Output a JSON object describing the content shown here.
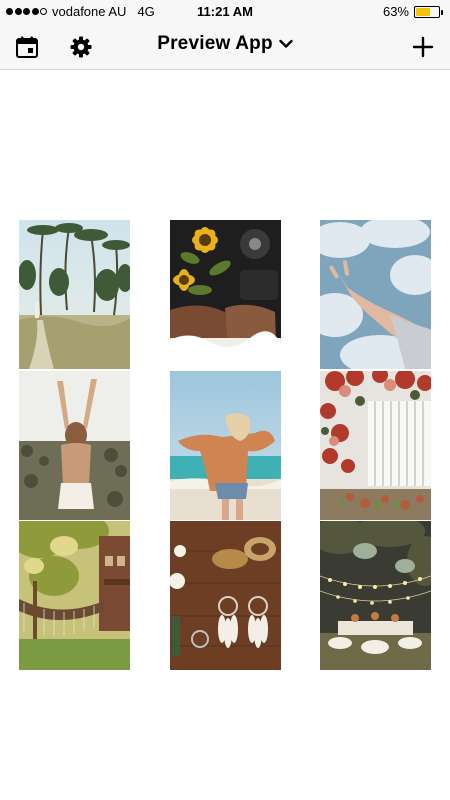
{
  "status_bar": {
    "carrier": "vodafone AU",
    "network": "4G",
    "time": "11:21 AM",
    "battery_percent": "63%",
    "battery_level": 0.63,
    "signal_bars_filled": 4,
    "battery_color": "#f5c10a"
  },
  "nav": {
    "title": "Preview App",
    "left_icons": [
      "calendar-icon",
      "gear-icon"
    ],
    "title_icon": "chevron-down-icon",
    "right_icon": "plus-icon"
  },
  "grid": {
    "columns": 3,
    "rows": 3,
    "photos": [
      "palm trees and path",
      "sunflower bouquet in car",
      "hand raised to sky",
      "woman arms raised in field",
      "woman at beach",
      "flower arch and picket fence",
      "treehouse with net bridge",
      "dreamcatcher flatlay",
      "garden party lights"
    ]
  }
}
